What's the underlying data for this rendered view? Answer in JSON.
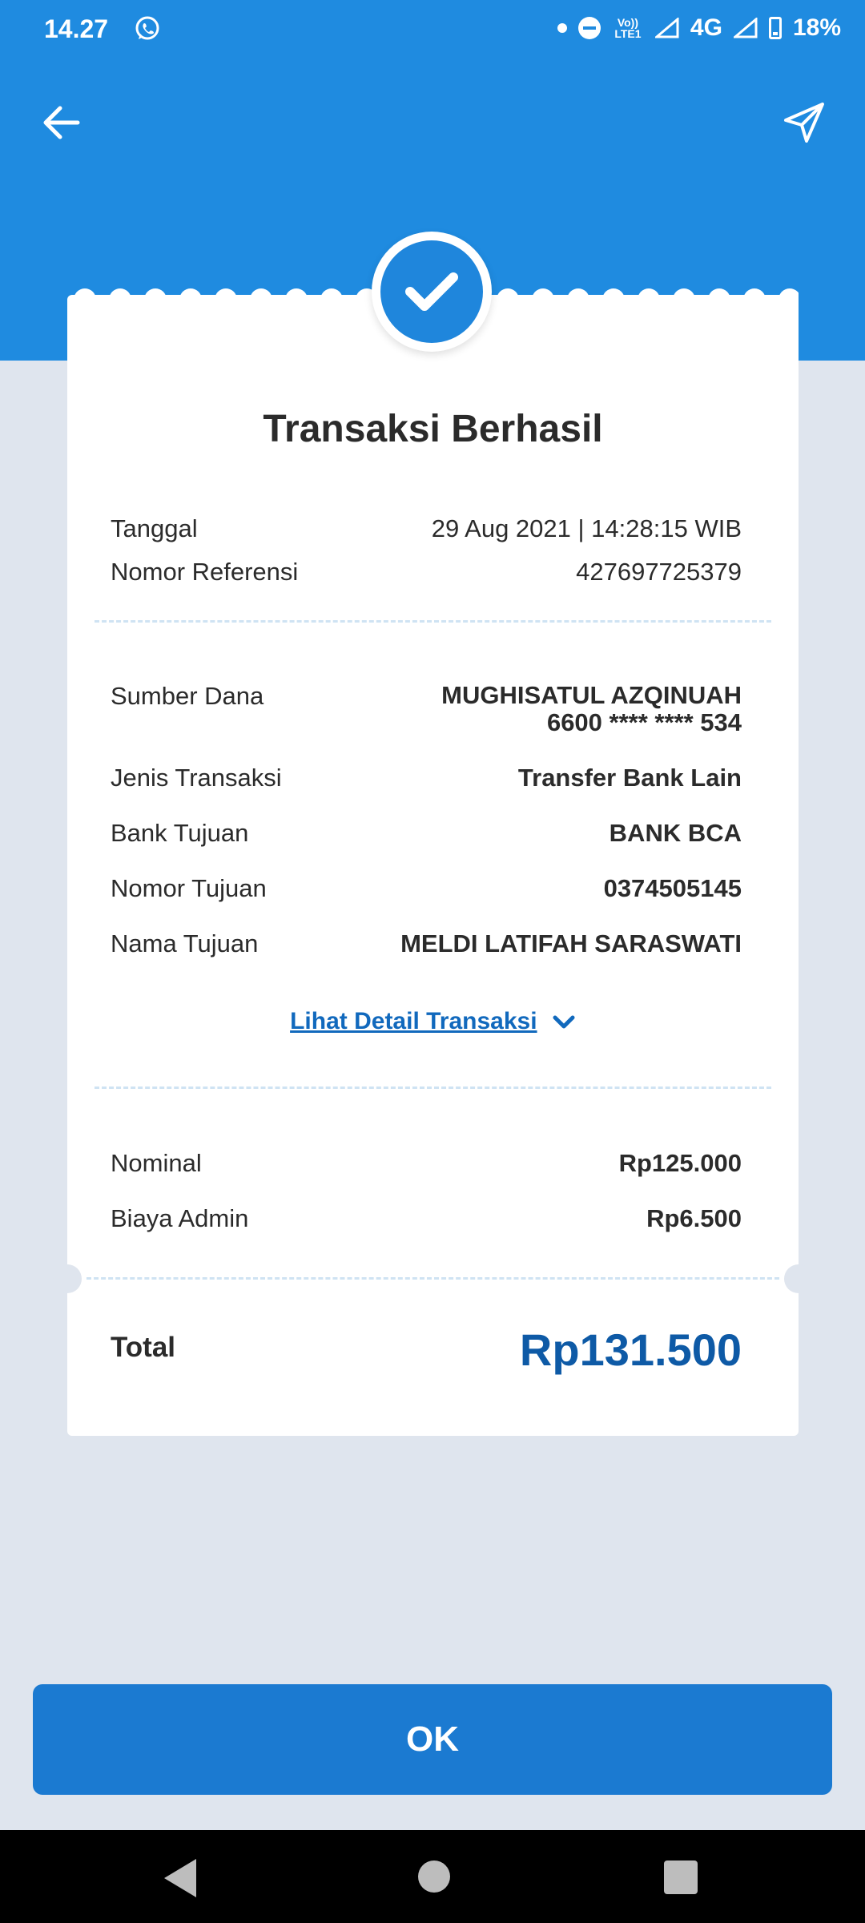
{
  "status_bar": {
    "time": "14.27",
    "network": "4G",
    "signal_label": "Vo)) LTE1",
    "battery": "18%"
  },
  "header": {
    "back_icon": "arrow-left-icon",
    "share_icon": "send-icon",
    "color": "#1f8be0"
  },
  "receipt": {
    "title": "Transaksi Berhasil",
    "info": [
      {
        "label": "Tanggal",
        "value": "29 Aug 2021 | 14:28:15 WIB"
      },
      {
        "label": "Nomor Referensi",
        "value": "427697725379"
      }
    ],
    "details": {
      "sumber_dana_label": "Sumber Dana",
      "sumber_dana_name": "MUGHISATUL AZQINUAH",
      "sumber_dana_account": "6600 **** **** 534",
      "rows": [
        {
          "label": "Jenis Transaksi",
          "value": "Transfer Bank Lain"
        },
        {
          "label": "Bank Tujuan",
          "value": "BANK BCA"
        },
        {
          "label": "Nomor Tujuan",
          "value": "0374505145"
        },
        {
          "label": "Nama Tujuan",
          "value": "MELDI LATIFAH SARASWATI"
        }
      ]
    },
    "detail_link": "Lihat Detail Transaksi",
    "amounts": [
      {
        "label": "Nominal",
        "value": "Rp125.000"
      },
      {
        "label": "Biaya Admin",
        "value": "Rp6.500"
      }
    ],
    "total_label": "Total",
    "total_value": "Rp131.500",
    "total_color": "#0e5aa6"
  },
  "ok_button": {
    "label": "OK",
    "color": "#1b7ad1"
  }
}
